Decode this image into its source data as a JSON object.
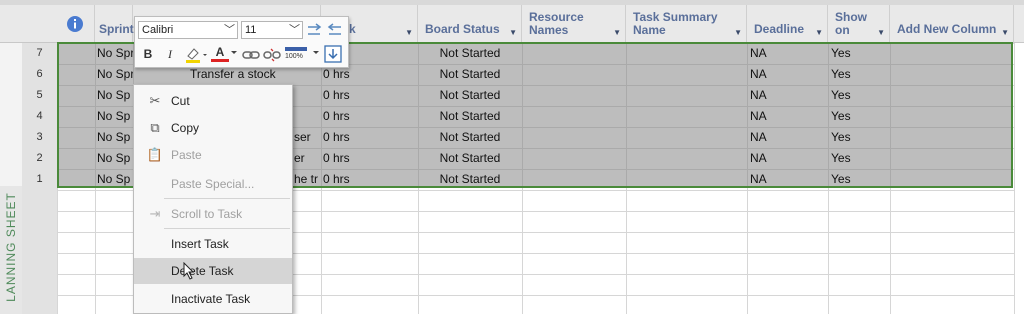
{
  "sheet_label": "LANNING SHEET",
  "columns": [
    {
      "id": "info",
      "label": ""
    },
    {
      "id": "sprint",
      "label": "Sprint"
    },
    {
      "id": "name",
      "label": ""
    },
    {
      "id": "work",
      "label": "k"
    },
    {
      "id": "board_status",
      "label": "Board Status"
    },
    {
      "id": "resource_names",
      "label": "Resource Names"
    },
    {
      "id": "task_summary",
      "label": "Task Summary Name"
    },
    {
      "id": "deadline",
      "label": "Deadline"
    },
    {
      "id": "show_on",
      "label": "Show on"
    },
    {
      "id": "add_new",
      "label": "Add New Column"
    }
  ],
  "info_icon": "info-icon",
  "rows": [
    {
      "num": "7",
      "sprint": "No Sprint",
      "name": "",
      "work": "s",
      "status": "Not Started",
      "deadline": "NA",
      "show": "Yes"
    },
    {
      "num": "6",
      "sprint": "No Sprint",
      "name": "Transfer a stock",
      "work": "0 hrs",
      "status": "Not Started",
      "deadline": "NA",
      "show": "Yes"
    },
    {
      "num": "5",
      "sprint": "No Sp",
      "name": "",
      "work": "0 hrs",
      "status": "Not Started",
      "deadline": "NA",
      "show": "Yes"
    },
    {
      "num": "4",
      "sprint": "No Sp",
      "name": "",
      "work": "0 hrs",
      "status": "Not Started",
      "deadline": "NA",
      "show": "Yes"
    },
    {
      "num": "3",
      "sprint": "No Sp",
      "name": "ser",
      "work": "0 hrs",
      "status": "Not Started",
      "deadline": "NA",
      "show": "Yes"
    },
    {
      "num": "2",
      "sprint": "No Sp",
      "name": "er",
      "work": "0 hrs",
      "status": "Not Started",
      "deadline": "NA",
      "show": "Yes"
    },
    {
      "num": "1",
      "sprint": "No Sp",
      "name": "he tr",
      "work": "0 hrs",
      "status": "Not Started",
      "deadline": "NA",
      "show": "Yes"
    }
  ],
  "mini_toolbar": {
    "font": "Calibri",
    "size": "11",
    "bold": "B",
    "italic": "I",
    "font_color": "A",
    "percent": "100%"
  },
  "context_menu": [
    {
      "label": "Cut",
      "icon": "scissors-icon",
      "glyph": "✂",
      "enabled": true
    },
    {
      "label": "Copy",
      "icon": "copy-icon",
      "glyph": "⧉",
      "enabled": true
    },
    {
      "label": "Paste",
      "icon": "paste-icon",
      "glyph": "📋",
      "enabled": false
    },
    {
      "label": "Paste Special...",
      "icon": "",
      "glyph": "",
      "enabled": false
    },
    {
      "label": "Scroll to Task",
      "icon": "scroll-to-task-icon",
      "glyph": "⇥",
      "enabled": false
    },
    {
      "label": "Insert Task",
      "icon": "",
      "glyph": "",
      "enabled": true
    },
    {
      "label": "Delete Task",
      "icon": "",
      "glyph": "",
      "enabled": true,
      "hover": true
    },
    {
      "label": "Inactivate Task",
      "icon": "",
      "glyph": "",
      "enabled": true
    }
  ],
  "colors": {
    "selection_border": "#4a8a3a",
    "header_text": "#5a6f9a",
    "sheet_label": "#4f8a5a"
  }
}
